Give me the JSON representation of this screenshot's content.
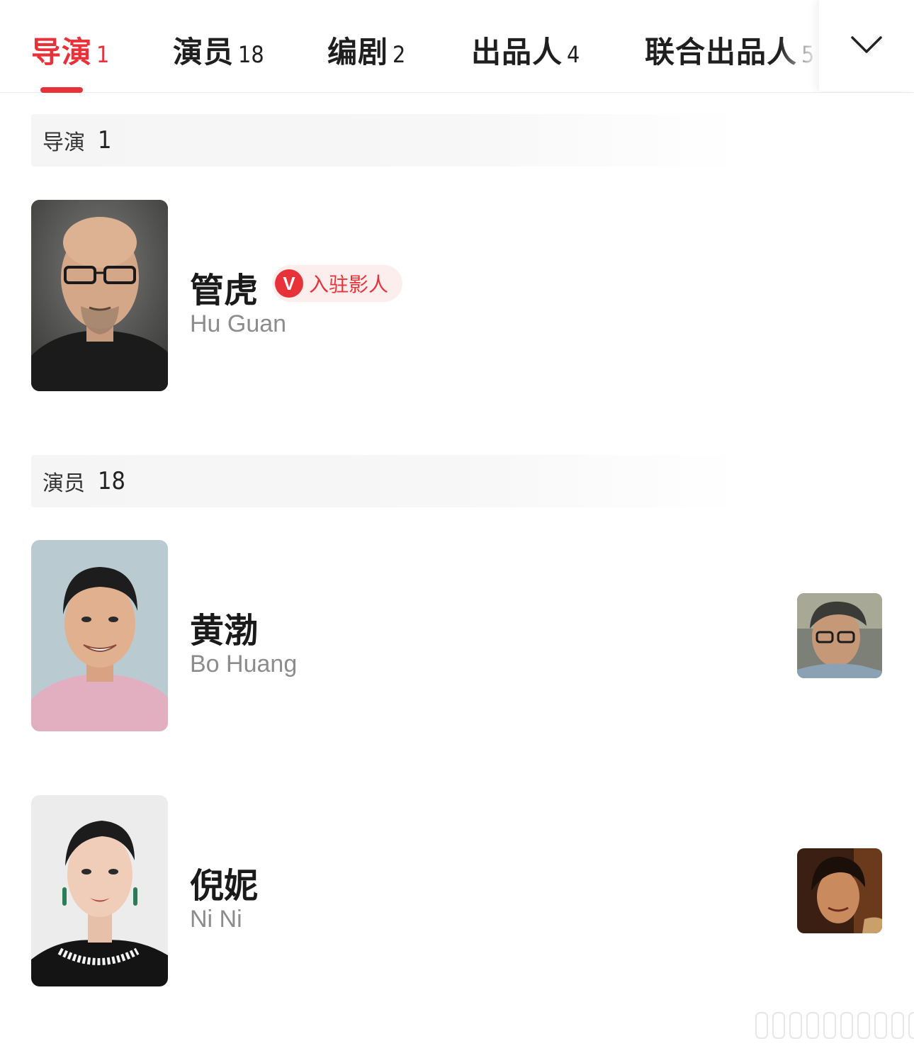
{
  "tabs": [
    {
      "label": "导演",
      "count": "1",
      "active": true
    },
    {
      "label": "演员",
      "count": "18",
      "active": false
    },
    {
      "label": "编剧",
      "count": "2",
      "active": false
    },
    {
      "label": "出品人",
      "count": "4",
      "active": false
    },
    {
      "label": "联合出品人",
      "count": "5",
      "active": false
    }
  ],
  "more_icon": "chevron-down-icon",
  "accent_color": "#e8323a",
  "sections": {
    "director": {
      "label": "导演",
      "count": "1",
      "people": [
        {
          "name": "管虎",
          "name_en": "Hu Guan",
          "badge_icon": "V",
          "badge_text": "入驻影人"
        }
      ]
    },
    "actors": {
      "label": "演员",
      "count": "18",
      "people": [
        {
          "name": "黄渤",
          "name_en": "Bo Huang"
        },
        {
          "name": "倪妮",
          "name_en": "Ni Ni"
        }
      ]
    }
  }
}
